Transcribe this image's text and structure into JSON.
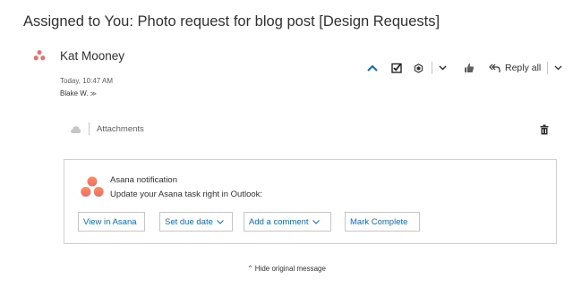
{
  "message": {
    "subject": "Assigned to You: Photo request for blog post [Design Requests]",
    "sender": "Kat Mooney",
    "time": "Today, 10:47 AM",
    "recipients": "Blake W."
  },
  "toolbar": {
    "reply_all_label": "Reply all"
  },
  "attachments": {
    "label": "Attachments"
  },
  "card": {
    "title": "Asana notification",
    "subtitle": "Update your Asana task right in Outlook:",
    "actions": [
      {
        "label": "View in Asana"
      },
      {
        "label": "Set due date"
      },
      {
        "label": "Add a comment"
      },
      {
        "label": "Mark Complete"
      }
    ]
  },
  "footer": {
    "hide_label": "Hide original message"
  },
  "colors": {
    "asana_coral": "#f06a6a",
    "asana_orange": "#fc8e5f",
    "accent_blue": "#0f6cbd"
  }
}
